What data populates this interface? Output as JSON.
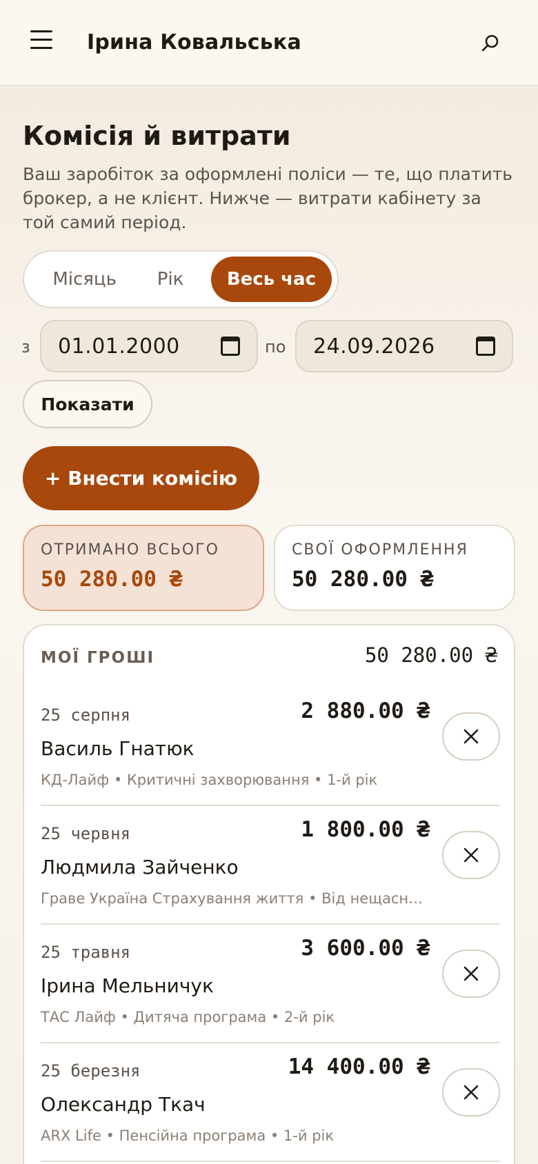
{
  "header": {
    "user_name": "Ірина Ковальська",
    "menu_icon": "menu-icon",
    "search_icon": "search-icon"
  },
  "page": {
    "title": "Комісія й витрати",
    "description": "Ваш заробіток за оформлені поліси — те, що платить брокер, а не клієнт. Нижче — витрати кабінету за той самий період."
  },
  "period_tabs": [
    {
      "label": "Місяць",
      "active": false
    },
    {
      "label": "Рік",
      "active": false
    },
    {
      "label": "Весь час",
      "active": true
    }
  ],
  "date_filter": {
    "from_label": "з",
    "from_value": "01.01.2000",
    "to_label": "по",
    "to_value": "24.09.2026",
    "calendar_icon": "calendar-icon"
  },
  "actions": {
    "show_label": "Показати",
    "add_label": "+ Внести комісію"
  },
  "stats": {
    "total_label": "ОТРИМАНО ВСЬОГО",
    "total_value": "50 280.00 ₴",
    "own_label": "СВОЇ ОФОРМЛЕННЯ",
    "own_value": "50 280.00 ₴"
  },
  "list": {
    "title": "МОЇ ГРОШІ",
    "total": "50 280.00 ₴",
    "items": [
      {
        "date": "25 серпня",
        "amount": "2 880.00 ₴",
        "name": "Василь Гнатюк",
        "meta": "КД-Лайф • Критичні захворювання • 1-й рік"
      },
      {
        "date": "25 червня",
        "amount": "1 800.00 ₴",
        "name": "Людмила Зайченко",
        "meta": "Граве Україна Страхування життя • Від нещасн…"
      },
      {
        "date": "25 травня",
        "amount": "3 600.00 ₴",
        "name": "Ірина Мельничук",
        "meta": "ТАС Лайф • Дитяча програма • 2-й рік"
      },
      {
        "date": "25 березня",
        "amount": "14 400.00 ₴",
        "name": "Олександр Ткач",
        "meta": "ARX Life • Пенсійна програма • 1-й рік"
      }
    ]
  },
  "colors": {
    "accent": "#a8480c",
    "background": "#f7f1e8",
    "card": "#ffffff",
    "total_card": "#f4e2d6"
  }
}
